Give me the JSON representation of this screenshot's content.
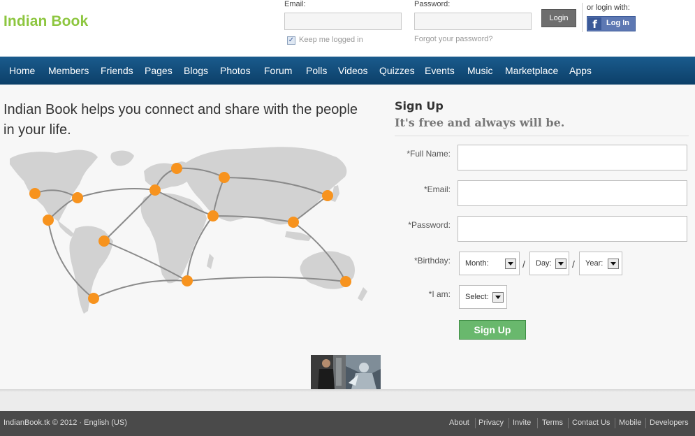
{
  "header": {
    "logo": "Indian Book",
    "email_label": "Email:",
    "password_label": "Password:",
    "login_button": "Login",
    "keep_logged_in": "Keep me logged in",
    "keep_logged_in_checked": true,
    "forgot_password": "Forgot your password?",
    "or_login_with": "or login with:",
    "facebook_login": "Log In",
    "facebook_icon": "f"
  },
  "nav": {
    "items": [
      "Home",
      "Members",
      "Friends",
      "Pages",
      "Blogs",
      "Photos",
      "Forum",
      "Polls",
      "Videos",
      "Quizzes",
      "Events",
      "Music",
      "Marketplace",
      "Apps"
    ]
  },
  "main": {
    "tagline": "Indian Book helps you connect and share with the people in your life."
  },
  "signup": {
    "title": "Sign Up",
    "subtitle": "It's free and always will be.",
    "full_name_label": "*Full Name:",
    "email_label": "*Email:",
    "password_label": "*Password:",
    "birthday_label": "*Birthday:",
    "month_select": "Month:",
    "day_select": "Day:",
    "year_select": "Year:",
    "separator": "/",
    "iam_label": "*I am:",
    "iam_select": "Select:",
    "button": "Sign Up"
  },
  "footer": {
    "copyright": "IndianBook.tk © 2012 · English (US)",
    "links": [
      "About",
      "Privacy",
      "Invite",
      "Terms",
      "Contact Us",
      "Mobile",
      "Developers"
    ]
  },
  "colors": {
    "logo": "#8dc63f",
    "nav_bg": "#0f4a78",
    "signup_button": "#69b86d",
    "map_marker": "#f7931e",
    "footer_bg": "#4a4a4a"
  }
}
